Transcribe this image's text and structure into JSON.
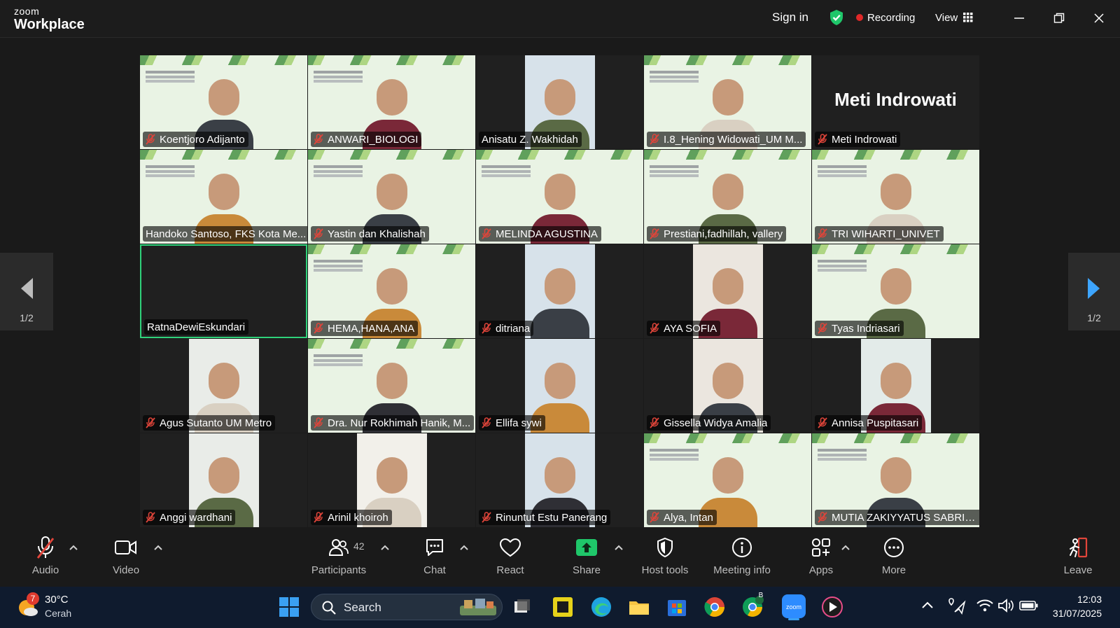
{
  "titlebar": {
    "brand_top": "zoom",
    "brand_bottom": "Workplace",
    "sign_in": "Sign in",
    "recording": "Recording",
    "view": "View"
  },
  "pager": {
    "left_count": "1/2",
    "right_count": "1/2"
  },
  "participants_tiles": [
    {
      "name": "Koentjoro Adijanto",
      "muted": true,
      "bg": "slide"
    },
    {
      "name": "ANWARI_BIOLOGI",
      "muted": true,
      "bg": "slide"
    },
    {
      "name": "Anisatu Z. Wakhidah",
      "muted": false,
      "bg": "cam"
    },
    {
      "name": "I.8_Hening Widowati_UM M...",
      "muted": true,
      "bg": "slide"
    },
    {
      "name": "Meti Indrowati",
      "muted": true,
      "bg": "dark",
      "big_label": "Meti Indrowati"
    },
    {
      "name": "Handoko Santoso, FKS Kota Me...",
      "muted": false,
      "bg": "slide"
    },
    {
      "name": "Yastin dan Khalishah",
      "muted": true,
      "bg": "slide"
    },
    {
      "name": "MELINDA AGUSTINA",
      "muted": true,
      "bg": "slide"
    },
    {
      "name": "Prestiani,fadhillah, vallery",
      "muted": true,
      "bg": "slide"
    },
    {
      "name": "TRI WIHARTI_UNIVET",
      "muted": true,
      "bg": "slide"
    },
    {
      "name": "RatnaDewiEskundari",
      "muted": false,
      "bg": "dark",
      "active": true
    },
    {
      "name": "HEMA,HANA,ANA",
      "muted": true,
      "bg": "slide"
    },
    {
      "name": "ditriana",
      "muted": true,
      "bg": "cam"
    },
    {
      "name": "AYA SOFIA",
      "muted": true,
      "bg": "cam"
    },
    {
      "name": "Tyas Indriasari",
      "muted": true,
      "bg": "slide"
    },
    {
      "name": "Agus Sutanto UM Metro",
      "muted": true,
      "bg": "cam"
    },
    {
      "name": "Dra. Nur Rokhimah Hanik, M...",
      "muted": true,
      "bg": "slide"
    },
    {
      "name": "Ellifa sywi",
      "muted": true,
      "bg": "cam"
    },
    {
      "name": "Gissella Widya Amalia",
      "muted": true,
      "bg": "cam"
    },
    {
      "name": "Annisa Puspitasari",
      "muted": true,
      "bg": "cam"
    },
    {
      "name": "Anggi wardhani",
      "muted": true,
      "bg": "cam"
    },
    {
      "name": "Arinil khoiroh",
      "muted": true,
      "bg": "cam"
    },
    {
      "name": "Rinuntut Estu Panerang",
      "muted": true,
      "bg": "cam"
    },
    {
      "name": "Alya, Intan",
      "muted": true,
      "bg": "slide"
    },
    {
      "name": "MUTIA ZAKIYYATUS SABRINA",
      "muted": true,
      "bg": "slide"
    }
  ],
  "toolbar": {
    "audio": "Audio",
    "video": "Video",
    "participants": "Participants",
    "participants_count": "42",
    "chat": "Chat",
    "react": "React",
    "share": "Share",
    "host_tools": "Host tools",
    "meeting_info": "Meeting info",
    "apps": "Apps",
    "more": "More",
    "leave": "Leave"
  },
  "taskbar": {
    "weather_temp": "30°C",
    "weather_cond": "Cerah",
    "weather_badge": "7",
    "search_label": "Search",
    "chrome_badge": "B",
    "time": "12:03",
    "date": "31/07/2025"
  },
  "colors": {
    "active_speaker": "#2fd27a",
    "recording_dot": "#e02828",
    "share_green": "#1fc76a",
    "mute_red": "#e0453a"
  }
}
